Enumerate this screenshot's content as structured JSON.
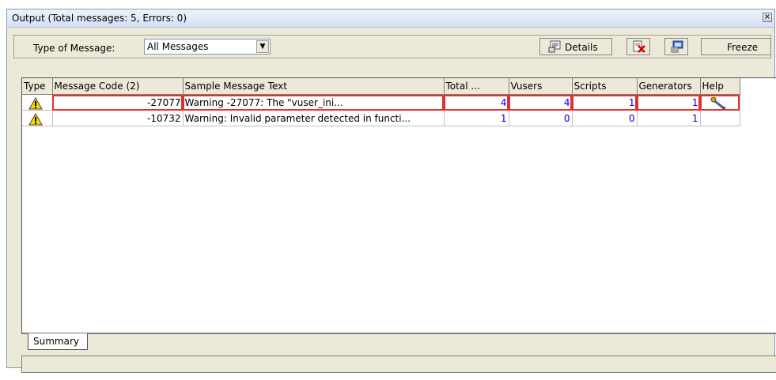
{
  "window": {
    "title": "Output (Total messages: 5,  Errors: 0)",
    "close_glyph": "×"
  },
  "toolbar": {
    "type_label": "Type of Message:",
    "type_value": "All Messages",
    "dropdown_glyph": "▼",
    "details_label": "Details",
    "freeze_label": "Freeze"
  },
  "grid": {
    "columns": [
      "Type",
      "Message Code (2)",
      "Sample Message Text",
      "Total ...",
      "Vusers",
      "Scripts",
      "Generators",
      "Help"
    ],
    "rows": [
      {
        "type_icon": "warning-icon",
        "code": "-27077",
        "text": "Warning -27077: The \"vuser_ini...",
        "total": "4",
        "vusers": "4",
        "scripts": "1",
        "generators": "1",
        "help_icon": "help-tool-icon"
      },
      {
        "type_icon": "warning-icon",
        "code": "-10732",
        "text": "Warning: Invalid parameter detected in functi...",
        "total": "1",
        "vusers": "0",
        "scripts": "0",
        "generators": "1",
        "help_icon": ""
      }
    ]
  },
  "tabs": [
    {
      "label": "Summary"
    }
  ],
  "colors": {
    "highlight": "#e03030",
    "numbers": "#0000cc",
    "panel": "#ece9d8"
  }
}
